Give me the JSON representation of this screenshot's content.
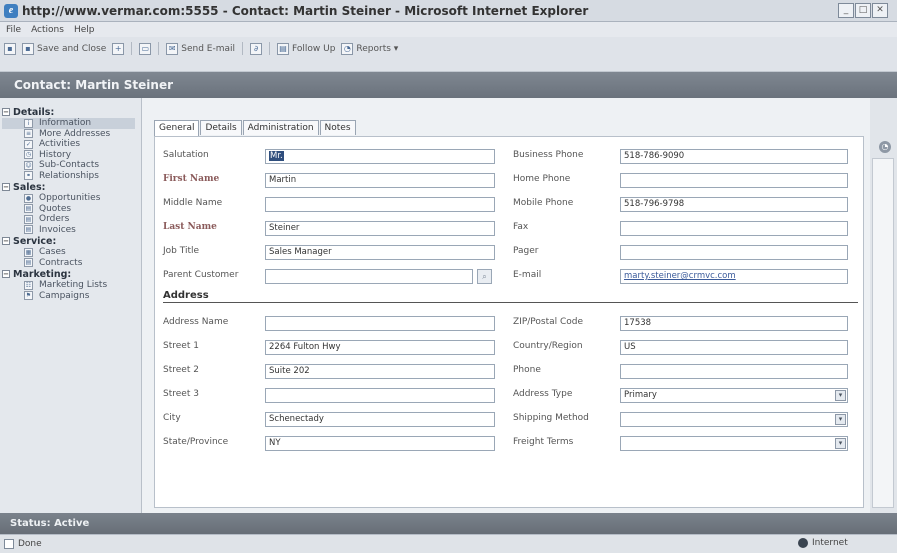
{
  "window": {
    "title": "http://www.vermar.com:5555 - Contact: Martin Steiner - Microsoft Internet Explorer"
  },
  "menu": [
    "File",
    "Actions",
    "Help"
  ],
  "toolbar": {
    "save_close": "Save and Close",
    "send_email": "Send E-mail",
    "follow_up": "Follow Up",
    "reports": "Reports ▾"
  },
  "header": {
    "title": "Contact: Martin Steiner"
  },
  "sidebar": {
    "details": "Details:",
    "details_items": [
      "Information",
      "More Addresses",
      "Activities",
      "History",
      "Sub-Contacts",
      "Relationships"
    ],
    "sales": "Sales:",
    "sales_items": [
      "Opportunities",
      "Quotes",
      "Orders",
      "Invoices"
    ],
    "service": "Service:",
    "service_items": [
      "Cases",
      "Contracts"
    ],
    "marketing": "Marketing:",
    "marketing_items": [
      "Marketing Lists",
      "Campaigns"
    ]
  },
  "tabs": [
    "General",
    "Details",
    "Administration",
    "Notes"
  ],
  "form": {
    "salutation": {
      "label": "Salutation",
      "value": "Mr."
    },
    "first_name": {
      "label": "First Name",
      "value": "Martin"
    },
    "middle_name": {
      "label": "Middle Name",
      "value": ""
    },
    "last_name": {
      "label": "Last Name",
      "value": "Steiner"
    },
    "job_title": {
      "label": "Job Title",
      "value": "Sales Manager"
    },
    "parent_customer": {
      "label": "Parent Customer",
      "value": ""
    },
    "business_phone": {
      "label": "Business Phone",
      "value": "518-786-9090"
    },
    "home_phone": {
      "label": "Home Phone",
      "value": ""
    },
    "mobile_phone": {
      "label": "Mobile Phone",
      "value": "518-796-9798"
    },
    "fax": {
      "label": "Fax",
      "value": ""
    },
    "pager": {
      "label": "Pager",
      "value": ""
    },
    "email": {
      "label": "E-mail",
      "value": "marty.steiner@crmvc.com"
    },
    "address_heading": "Address",
    "address_name": {
      "label": "Address Name",
      "value": ""
    },
    "street1": {
      "label": "Street 1",
      "value": "2264 Fulton Hwy"
    },
    "street2": {
      "label": "Street 2",
      "value": "Suite 202"
    },
    "street3": {
      "label": "Street 3",
      "value": ""
    },
    "city": {
      "label": "City",
      "value": "Schenectady"
    },
    "state": {
      "label": "State/Province",
      "value": "NY"
    },
    "zip": {
      "label": "ZIP/Postal Code",
      "value": "17538"
    },
    "country": {
      "label": "Country/Region",
      "value": "US"
    },
    "phone": {
      "label": "Phone",
      "value": ""
    },
    "address_type": {
      "label": "Address Type",
      "value": "Primary"
    },
    "shipping_method": {
      "label": "Shipping Method",
      "value": ""
    },
    "freight_terms": {
      "label": "Freight Terms",
      "value": ""
    }
  },
  "status": {
    "text": "Status: Active"
  },
  "iestatus": {
    "done": "Done",
    "zone": "Internet"
  }
}
